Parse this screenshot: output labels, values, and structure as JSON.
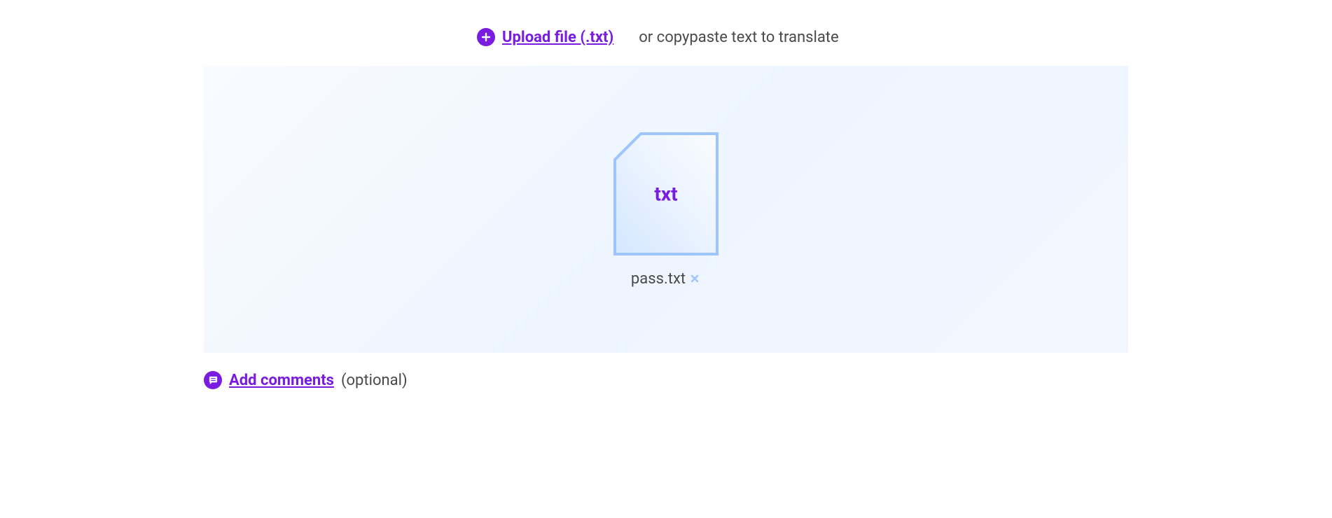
{
  "header": {
    "upload_link_label": "Upload file (.txt)",
    "or_text": "or copypaste text to translate"
  },
  "dropzone": {
    "file_ext_label": "txt",
    "file_name": "pass.txt"
  },
  "comments": {
    "link_label": "Add comments",
    "optional_label": "(optional)"
  }
}
